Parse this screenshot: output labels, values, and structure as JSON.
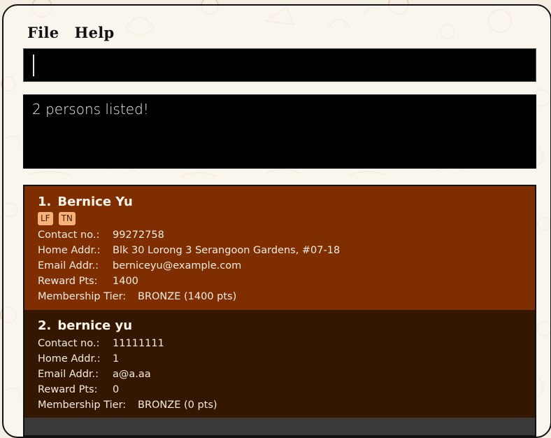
{
  "menu": {
    "file": "File",
    "help": "Help"
  },
  "command": {
    "value": "",
    "placeholder": ""
  },
  "result": {
    "message": "2 persons listed!"
  },
  "persons": [
    {
      "index": "1.",
      "name": "Bernice Yu",
      "tags": [
        "LF",
        "TN"
      ],
      "contact_label": "Contact no.:",
      "contact": "99272758",
      "address_label": "Home Addr.:",
      "address": "Blk 30 Lorong 3 Serangoon Gardens, #07-18",
      "email_label": "Email Addr.:",
      "email": "berniceyu@example.com",
      "points_label": "Reward Pts:",
      "points": "1400",
      "tier_label": "Membership Tier:",
      "tier": "BRONZE (1400 pts)"
    },
    {
      "index": "2.",
      "name": "bernice yu",
      "tags": [],
      "contact_label": "Contact no.:",
      "contact": "11111111",
      "address_label": "Home Addr.:",
      "address": "1",
      "email_label": "Email Addr.:",
      "email": "a@a.aa",
      "points_label": "Reward Pts:",
      "points": "0",
      "tier_label": "Membership Tier:",
      "tier": "BRONZE (0 pts)"
    }
  ],
  "colors": {
    "selected_card": "#7e2e00",
    "card": "#341700",
    "tag": "#f5b37a",
    "box": "#000000"
  }
}
